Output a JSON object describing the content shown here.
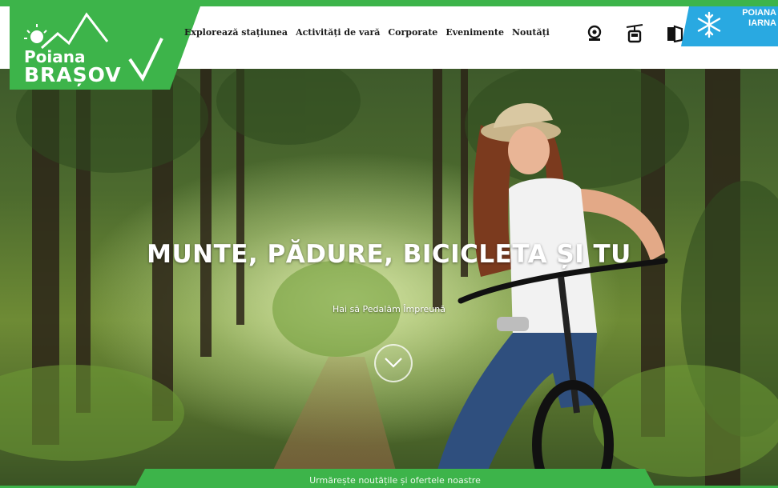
{
  "brand": {
    "line1": "Poiana",
    "line2": "BRAȘOV",
    "green": "#3db44a",
    "dark_green": "#2a8f38"
  },
  "nav": {
    "items": [
      {
        "label": "Explorează stațiunea"
      },
      {
        "label": "Activități de vară"
      },
      {
        "label": "Corporate"
      },
      {
        "label": "Evenimente"
      },
      {
        "label": "Noutăți"
      }
    ]
  },
  "utility_icons": [
    "webcam-icon",
    "cable-car-icon",
    "doors-icon"
  ],
  "winter_link": {
    "line1": "POIANA",
    "line2": "IARNA",
    "icon": "snowflake-icon",
    "color": "#29a9e1"
  },
  "hero": {
    "title": "MUNTE, PĂDURE, BICICLETA ȘI TU",
    "subtitle": "Hai să Pedalăm Împreună",
    "scroll_icon": "chevron-down-icon"
  },
  "bottom_tab": {
    "label": "Urmărește noutățile și ofertele noastre"
  }
}
